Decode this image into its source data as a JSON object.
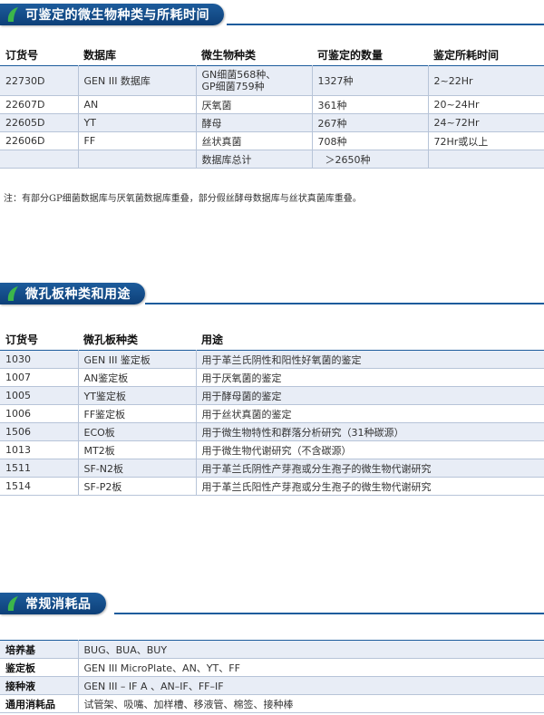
{
  "section1": {
    "title": "可鉴定的微生物种类与所耗时间",
    "headers": [
      "订货号",
      "数据库",
      "微生物种类",
      "可鉴定的数量",
      "鉴定所耗时间"
    ],
    "rows": [
      [
        "22730D",
        "GEN III 数据库",
        "GN细菌568种、\nGP细菌759种",
        "1327种",
        "2~22Hr"
      ],
      [
        "22607D",
        "AN",
        "厌氧菌",
        "361种",
        "20~24Hr"
      ],
      [
        "22605D",
        "YT",
        "酵母",
        "267种",
        "24~72Hr"
      ],
      [
        "22606D",
        "FF",
        "丝状真菌",
        "708种",
        "72Hr或以上"
      ],
      [
        "",
        "",
        "数据库总计",
        "＞2650种",
        ""
      ]
    ],
    "note": "注：有部分GP细菌数据库与厌氧菌数据库重叠，部分假丝酵母数据库与丝状真菌库重叠。"
  },
  "section2": {
    "title": "微孔板种类和用途",
    "headers": [
      "订货号",
      "微孔板种类",
      "用途"
    ],
    "rows": [
      [
        "1030",
        "GEN III 鉴定板",
        "用于革兰氏阴性和阳性好氧菌的鉴定"
      ],
      [
        "1007",
        "AN鉴定板",
        "用于厌氧菌的鉴定"
      ],
      [
        "1005",
        "YT鉴定板",
        "用于酵母菌的鉴定"
      ],
      [
        "1006",
        "FF鉴定板",
        "用于丝状真菌的鉴定"
      ],
      [
        "1506",
        "ECO板",
        "用于微生物特性和群落分析研究（31种碳源）"
      ],
      [
        "1013",
        "MT2板",
        "用于微生物代谢研究（不含碳源）"
      ],
      [
        "1511",
        "SF-N2板",
        "用于革兰氏阴性产芽孢或分生孢子的微生物代谢研究"
      ],
      [
        "1514",
        "SF-P2板",
        "用于革兰氏阳性产芽孢或分生孢子的微生物代谢研究"
      ]
    ]
  },
  "section3": {
    "title": "常规消耗品",
    "rows": [
      [
        "培养基",
        "BUG、BUA、BUY"
      ],
      [
        "鉴定板",
        "GEN III MicroPlate、AN、YT、FF"
      ],
      [
        "接种液",
        "GEN III – IF A 、AN–IF、FF–IF"
      ],
      [
        "通用消耗品",
        "试管架、吸嘴、加样槽、移液管、棉签、接种棒"
      ]
    ]
  },
  "colors": {
    "header_blue": "#1d5c9c",
    "row_tint": "#e8edf6",
    "icon_green": "#3cb64a"
  }
}
